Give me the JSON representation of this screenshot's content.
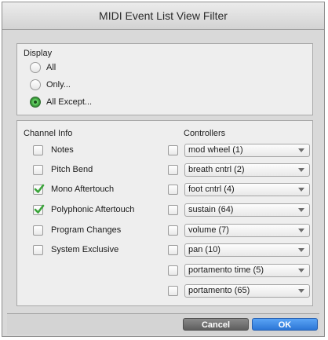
{
  "window": {
    "title": "MIDI Event List View Filter"
  },
  "display": {
    "label": "Display",
    "options": [
      {
        "label": "All",
        "selected": false
      },
      {
        "label": "Only...",
        "selected": false
      },
      {
        "label": "All Except...",
        "selected": true
      }
    ]
  },
  "channel_info": {
    "label": "Channel Info",
    "items": [
      {
        "label": "Notes",
        "checked": false
      },
      {
        "label": "Pitch Bend",
        "checked": false
      },
      {
        "label": "Mono Aftertouch",
        "checked": true
      },
      {
        "label": "Polyphonic Aftertouch",
        "checked": true
      },
      {
        "label": "Program Changes",
        "checked": false
      },
      {
        "label": "System Exclusive",
        "checked": false
      }
    ]
  },
  "controllers": {
    "label": "Controllers",
    "items": [
      {
        "value": "mod wheel (1)",
        "checked": false
      },
      {
        "value": "breath cntrl (2)",
        "checked": false
      },
      {
        "value": "foot cntrl (4)",
        "checked": false
      },
      {
        "value": "sustain (64)",
        "checked": false
      },
      {
        "value": "volume (7)",
        "checked": false
      },
      {
        "value": "pan (10)",
        "checked": false
      },
      {
        "value": "portamento time (5)",
        "checked": false
      },
      {
        "value": "portamento (65)",
        "checked": false
      }
    ]
  },
  "buttons": {
    "cancel": "Cancel",
    "ok": "OK"
  },
  "colors": {
    "accent_green": "#3a9a3a",
    "ok_blue": "#2c76d6",
    "cancel_gray": "#5e5e5e"
  }
}
